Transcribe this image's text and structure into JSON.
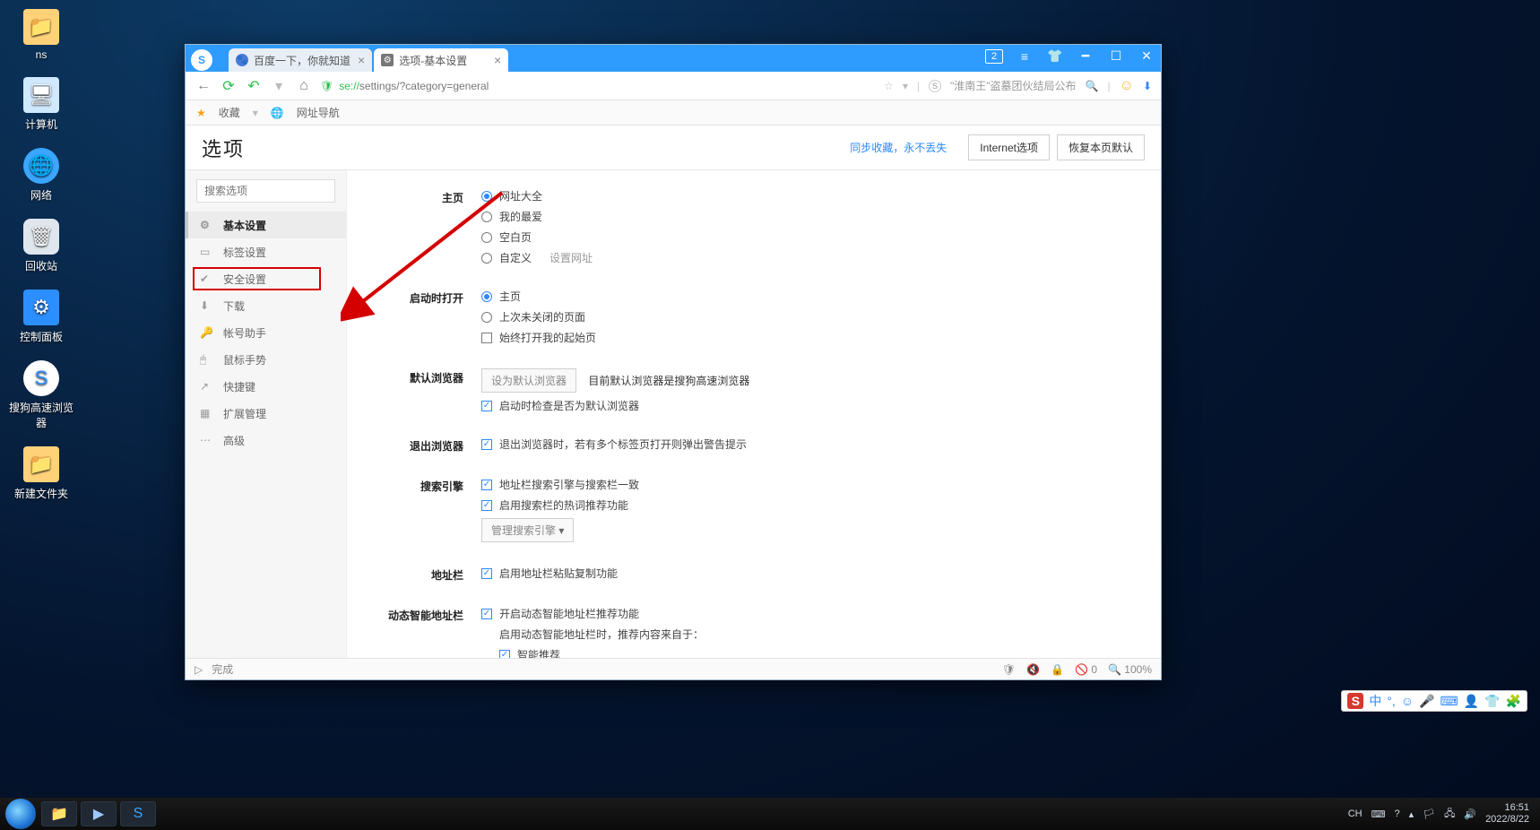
{
  "desktop": {
    "icons": [
      "ns",
      "计算机",
      "网络",
      "回收站",
      "控制面板",
      "搜狗高速浏览器",
      "新建文件夹"
    ]
  },
  "browser": {
    "tabs": [
      {
        "title": "百度一下，你就知道"
      },
      {
        "title": "选项-基本设置"
      }
    ],
    "window_badge": "2",
    "address": {
      "scheme": "se://",
      "path": "settings/?category=general"
    },
    "addr_right": {
      "hint": "\"淮南王\"盗墓团伙结局公布"
    },
    "favbar": {
      "favorites": "收藏",
      "nav": "网址导航"
    },
    "status": {
      "done": "完成",
      "zoom": "100%",
      "blocked": "0"
    }
  },
  "settings": {
    "title": "选项",
    "sync_link": "同步收藏，永不丢失",
    "btn_ie": "Internet选项",
    "btn_reset": "恢复本页默认",
    "search_placeholder": "搜索选项",
    "sidebar": [
      "基本设置",
      "标签设置",
      "安全设置",
      "下载",
      "帐号助手",
      "鼠标手势",
      "快捷键",
      "扩展管理",
      "高级"
    ],
    "sections": {
      "home": {
        "label": "主页",
        "opts": [
          "网址大全",
          "我的最爱",
          "空白页",
          "自定义"
        ],
        "custom_link": "设置网址"
      },
      "startup": {
        "label": "启动时打开",
        "opts": [
          "主页",
          "上次未关闭的页面"
        ],
        "check": "始终打开我的起始页"
      },
      "default_browser": {
        "label": "默认浏览器",
        "set_btn": "设为默认浏览器",
        "status": "目前默认浏览器是搜狗高速浏览器",
        "check": "启动时检查是否为默认浏览器"
      },
      "exit": {
        "label": "退出浏览器",
        "check": "退出浏览器时，若有多个标签页打开则弹出警告提示"
      },
      "search": {
        "label": "搜索引擎",
        "check1": "地址栏搜索引擎与搜索栏一致",
        "check2": "启用搜索栏的热词推荐功能",
        "manage": "管理搜索引擎"
      },
      "addrbar": {
        "label": "地址栏",
        "check": "启用地址栏粘贴复制功能"
      },
      "smart": {
        "label": "动态智能地址栏",
        "check": "开启动态智能地址栏推荐功能",
        "note": "启用动态智能地址栏时，推荐内容来自于：",
        "sub": "智能推荐"
      }
    }
  },
  "ime": {
    "lang": "中"
  },
  "taskbar": {
    "tray_text": "CH",
    "time": "16:51",
    "date": "2022/8/22"
  }
}
